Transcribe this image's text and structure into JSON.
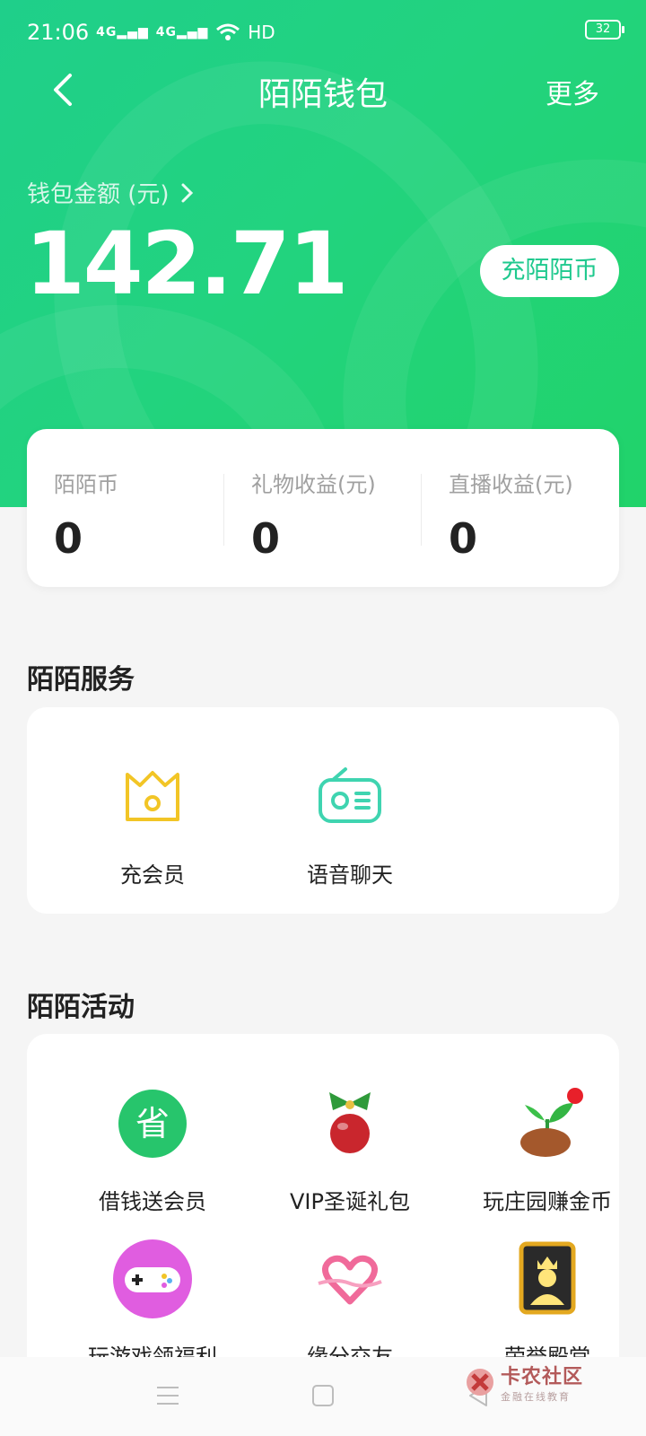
{
  "status_bar": {
    "time": "21:06",
    "network1": "4G",
    "network2": "4G",
    "hd": "HD",
    "battery": "32"
  },
  "nav": {
    "title": "陌陌钱包",
    "more": "更多"
  },
  "wallet": {
    "label": "钱包金额 (元)",
    "amount": "142.71",
    "recharge_button": "充陌陌币"
  },
  "stats": [
    {
      "label": "陌陌币",
      "value": "0"
    },
    {
      "label": "礼物收益(元)",
      "value": "0"
    },
    {
      "label": "直播收益(元)",
      "value": "0"
    }
  ],
  "services": {
    "title": "陌陌服务",
    "items": [
      {
        "label": "充会员",
        "icon": "crown-icon"
      },
      {
        "label": "语音聊天",
        "icon": "radio-icon"
      }
    ]
  },
  "activities": {
    "title": "陌陌活动",
    "items": [
      {
        "label": "借钱送会员",
        "icon": "save-money-icon"
      },
      {
        "label": "VIP圣诞礼包",
        "icon": "christmas-ornament-icon"
      },
      {
        "label": "玩庄园赚金币",
        "icon": "sprout-icon"
      },
      {
        "label": "玩游戏领福利",
        "icon": "gamepad-icon"
      },
      {
        "label": "缘分交友",
        "icon": "heart-icon"
      },
      {
        "label": "荣誉殿堂",
        "icon": "king-portrait-icon"
      }
    ]
  },
  "watermark": {
    "title": "卡农社区",
    "subtitle": "金融在线教育"
  },
  "colors": {
    "brand_green": "#1fd07f",
    "accent_teal": "#1fc98e",
    "crown_yellow": "#f2c526",
    "notify_red": "#e8202a"
  }
}
